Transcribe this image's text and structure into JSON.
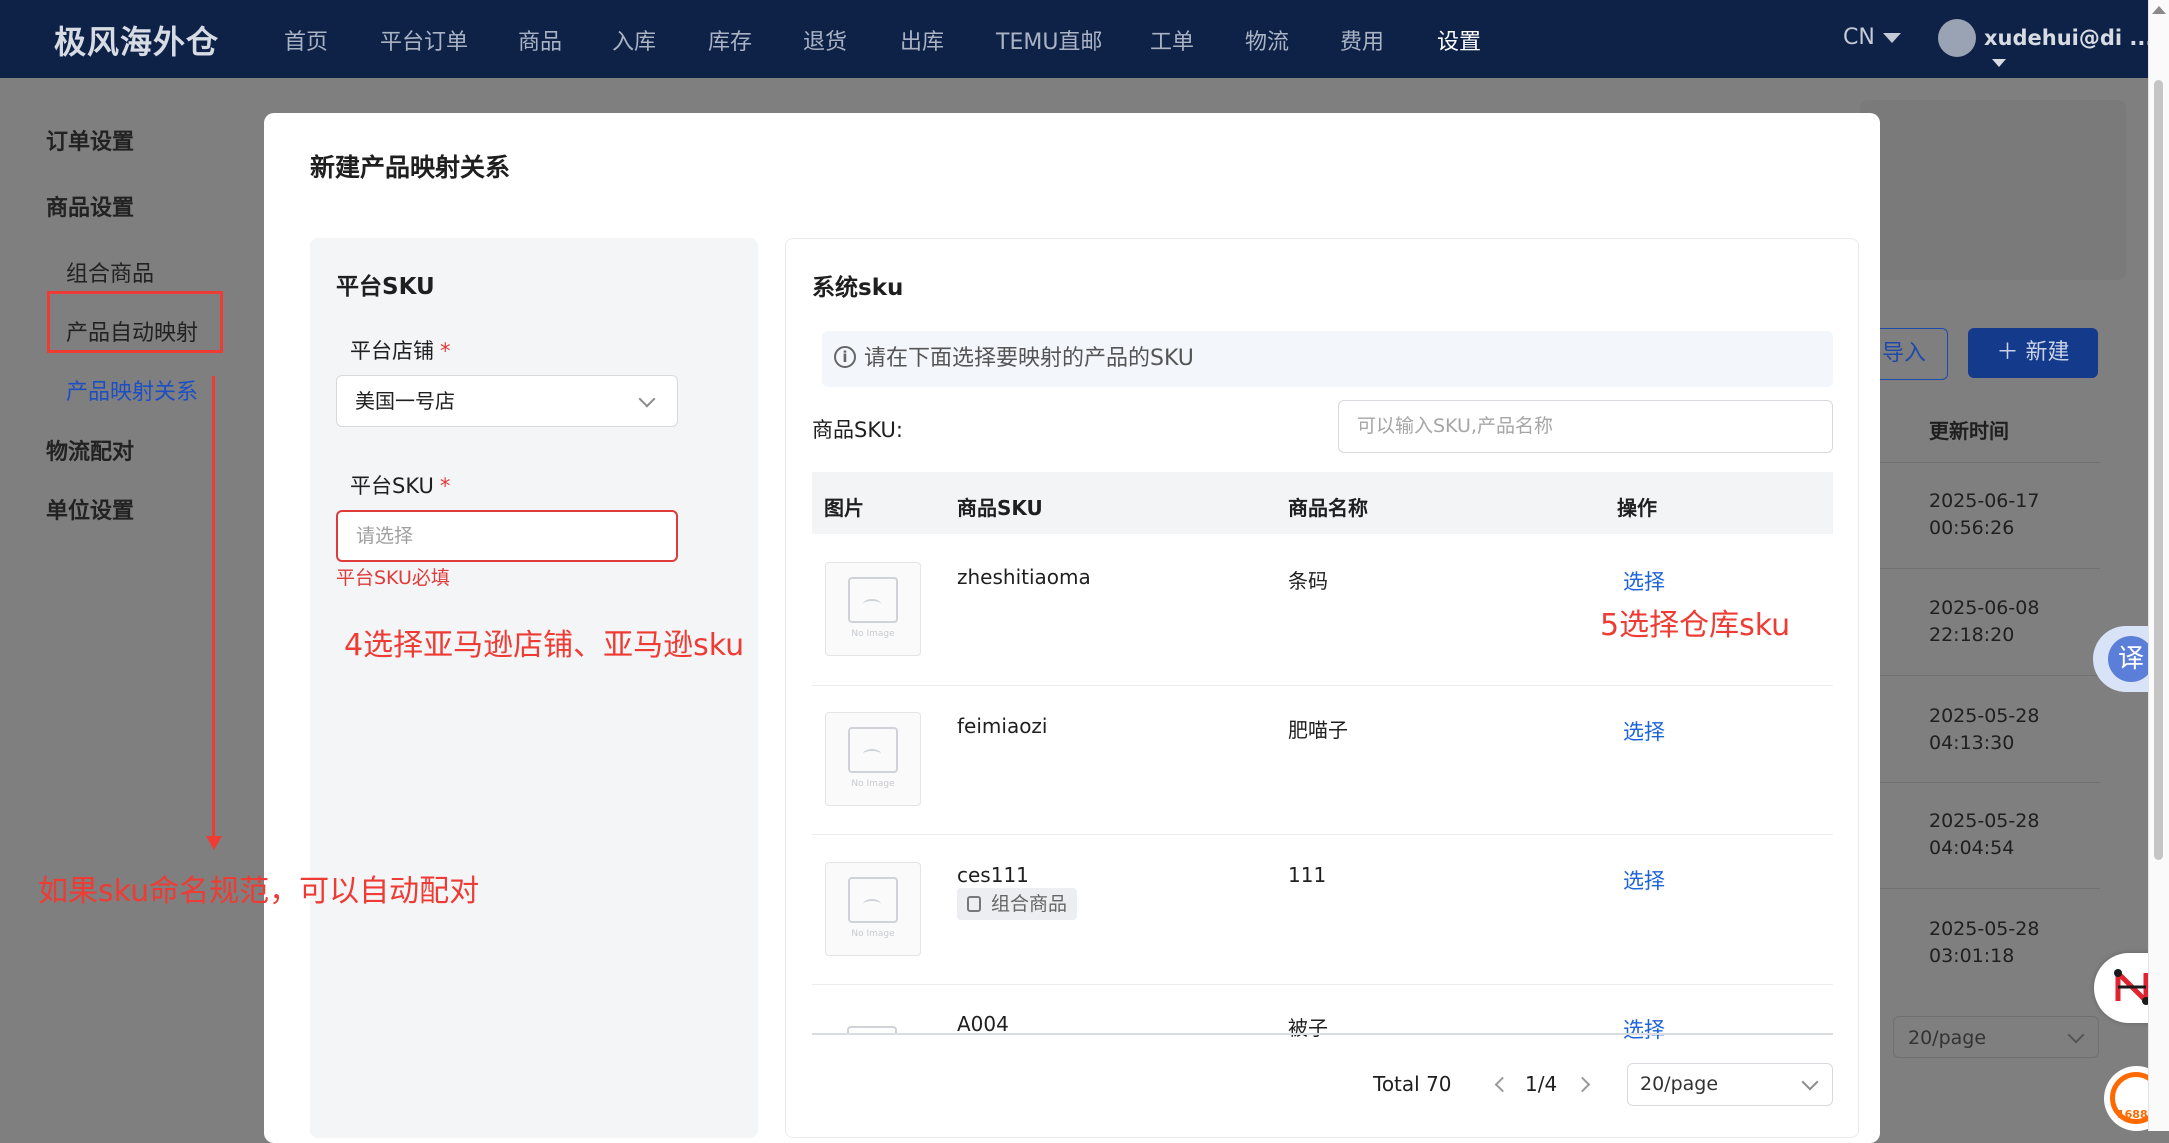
{
  "header": {
    "logo": "极风海外仓",
    "nav": [
      "首页",
      "平台订单",
      "商品",
      "入库",
      "库存",
      "退货",
      "出库",
      "TEMU直邮",
      "工单",
      "物流",
      "费用",
      "设置"
    ],
    "active_nav": "设置",
    "lang": "CN",
    "user": "xudehui@di ..."
  },
  "sidebar": {
    "order_settings": "订单设置",
    "product_settings": "商品设置",
    "combo_product": "组合商品",
    "auto_mapping": "产品自动映射",
    "mapping_relation": "产品映射关系",
    "logistics_pairing": "物流配对",
    "unit_settings": "单位设置"
  },
  "background_page": {
    "import_button": "导入",
    "new_button": "新建",
    "column_update_time": "更新时间",
    "times": [
      [
        "2025-06-17",
        "00:56:26"
      ],
      [
        "2025-06-08",
        "22:18:20"
      ],
      [
        "2025-05-28",
        "04:13:30"
      ],
      [
        "2025-05-28",
        "04:04:54"
      ],
      [
        "2025-05-28",
        "03:01:18"
      ]
    ],
    "page_size": "20/page"
  },
  "modal": {
    "title": "新建产品映射关系",
    "left": {
      "title": "平台SKU",
      "store_label": "平台店铺",
      "store_value": "美国一号店",
      "sku_label": "平台SKU",
      "sku_placeholder": "请选择",
      "sku_error": "平台SKU必填"
    },
    "right": {
      "title": "系统sku",
      "info": "请在下面选择要映射的产品的SKU",
      "search_label": "商品SKU:",
      "search_placeholder": "可以输入SKU,产品名称",
      "columns": {
        "image": "图片",
        "sku": "商品SKU",
        "name": "商品名称",
        "action": "操作"
      },
      "rows": [
        {
          "sku": "zheshitiaoma",
          "name": "条码",
          "action": "选择",
          "tag": ""
        },
        {
          "sku": "feimiaozi",
          "name": "肥喵子",
          "action": "选择",
          "tag": ""
        },
        {
          "sku": "ces111",
          "name": "111",
          "action": "选择",
          "tag": "组合商品"
        },
        {
          "sku": "A004",
          "name": "被子",
          "action": "选择",
          "tag": ""
        }
      ],
      "no_image": "No Image",
      "total": "Total 70",
      "page": "1/4",
      "page_size": "20/page"
    }
  },
  "annotations": {
    "step4": "4选择亚马逊店铺、亚马逊sku",
    "step5": "5选择仓库sku",
    "auto_pair_note": "如果sku命名规范，可以自动配对"
  },
  "widgets": {
    "translate": "译",
    "brand_1688": "1688"
  },
  "colors": {
    "nav_bg": "#0e2247",
    "link": "#1d63d8",
    "annotation": "#ee3b34",
    "error": "#e03b3b"
  }
}
